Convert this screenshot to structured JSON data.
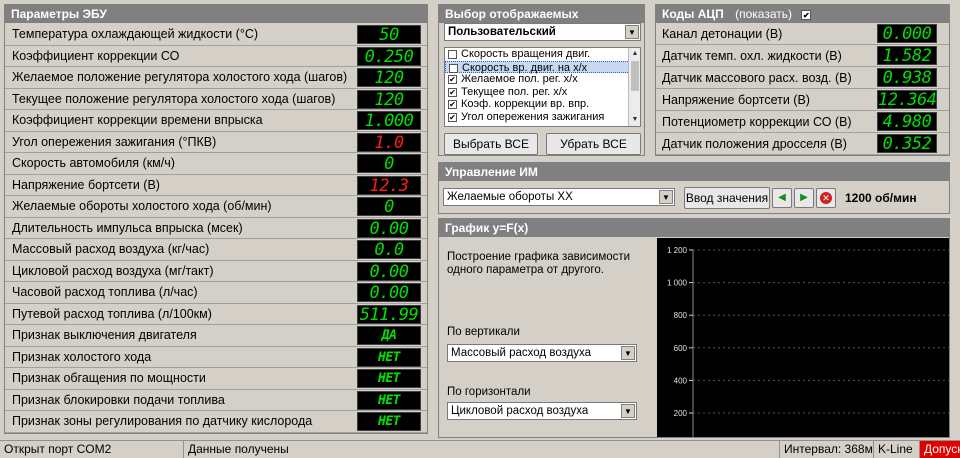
{
  "ecu_panel": {
    "title": "Параметры ЭБУ",
    "rows": [
      {
        "label": "Температура охлаждающей жидкости (°С)",
        "value": "50",
        "color": "green"
      },
      {
        "label": "Коэффициент коррекции СО",
        "value": "0.250",
        "color": "green"
      },
      {
        "label": "Желаемое положение регулятора холостого хода (шагов)",
        "value": "120",
        "color": "green"
      },
      {
        "label": "Текущее положение регулятора холостого хода (шагов)",
        "value": "120",
        "color": "green"
      },
      {
        "label": "Коэффициент коррекции времени впрыска",
        "value": "1.000",
        "color": "green"
      },
      {
        "label": "Угол опережения зажигания (°ПКВ)",
        "value": "1.0",
        "color": "red"
      },
      {
        "label": "Скорость автомобиля (км/ч)",
        "value": "0",
        "color": "green"
      },
      {
        "label": "Напряжение бортсети (В)",
        "value": "12.3",
        "color": "red"
      },
      {
        "label": "Желаемые обороты холостого хода (об/мин)",
        "value": "0",
        "color": "green"
      },
      {
        "label": "Длительность импульса впрыска (мсек)",
        "value": "0.00",
        "color": "green"
      },
      {
        "label": "Массовый расход воздуха (кг/час)",
        "value": "0.0",
        "color": "green"
      },
      {
        "label": "Цикловой расход воздуха (мг/такт)",
        "value": "0.00",
        "color": "green"
      },
      {
        "label": "Часовой расход топлива (л/час)",
        "value": "0.00",
        "color": "green"
      },
      {
        "label": "Путевой расход топлива (л/100км)",
        "value": "511.99",
        "color": "green"
      },
      {
        "label": "Признак выключения двигателя",
        "value": "ДА",
        "color": "green",
        "word": true
      },
      {
        "label": "Признак холостого хода",
        "value": "НЕТ",
        "color": "green",
        "word": true
      },
      {
        "label": "Признак обгащения по мощности",
        "value": "НЕТ",
        "color": "green",
        "word": true
      },
      {
        "label": "Признак блокировки подачи топлива",
        "value": "НЕТ",
        "color": "green",
        "word": true
      },
      {
        "label": "Признак зоны регулирования по датчику кислорода",
        "value": "НЕТ",
        "color": "green",
        "word": true
      }
    ]
  },
  "select_panel": {
    "title": "Выбор отображаемых параметров",
    "mode": "Пользовательский",
    "items": [
      {
        "label": "Скорость вращения двиг.",
        "checked": false
      },
      {
        "label": "Скорость вр. двиг. на х/х",
        "checked": false,
        "highlighted": true
      },
      {
        "label": "Желаемое пол. рег. х/х",
        "checked": true
      },
      {
        "label": "Текущее пол. рег. х/х",
        "checked": true
      },
      {
        "label": "Коэф. коррекции вр. впр.",
        "checked": true
      },
      {
        "label": "Угол опережения зажигания",
        "checked": true
      }
    ],
    "select_all": "Выбрать ВСЕ",
    "remove_all": "Убрать ВСЕ"
  },
  "adc_panel": {
    "title": "Коды АЦП",
    "show_label": "(показать)",
    "show_checked": true,
    "rows": [
      {
        "label": "Канал детонации (В)",
        "value": "0.000"
      },
      {
        "label": "Датчик темп. охл. жидкости (В)",
        "value": "1.582"
      },
      {
        "label": "Датчик массового расх. возд. (В)",
        "value": "0.938"
      },
      {
        "label": "Напряжение бортсети (В)",
        "value": "12.364"
      },
      {
        "label": "Потенциометр коррекции СО (В)",
        "value": "4.980"
      },
      {
        "label": "Датчик положения дросселя (В)",
        "value": "0.352"
      }
    ]
  },
  "actuator_panel": {
    "title": "Управление ИМ",
    "selected": "Желаемые обороты ХХ",
    "enter_value": "Ввод значения",
    "readout": "1200 об/мин"
  },
  "graph_panel": {
    "title": "График y=F(x)",
    "description": "Построение графика зависимости одного параметра от другого.",
    "vertical_label": "По вертикали",
    "vertical_value": "Массовый расход воздуха",
    "horizontal_label": "По горизонтали",
    "horizontal_value": "Цикловой расход воздуха"
  },
  "chart_data": {
    "type": "line",
    "ylim": [
      0,
      1200
    ],
    "yticks": [
      "1 200",
      "1 000",
      "800",
      "600",
      "400",
      "200"
    ],
    "series": [],
    "grid": true
  },
  "status_bar": {
    "port": "Открыт порт COM2",
    "data": "Данные получены",
    "interval": "Интервал: 368мс",
    "protocol": "K-Line",
    "alert": "Допуск"
  },
  "colors": {
    "lcd_green": "#00e000",
    "lcd_red": "#ff1a1a",
    "panel_header": "#808080",
    "alert_red": "#e00000"
  }
}
